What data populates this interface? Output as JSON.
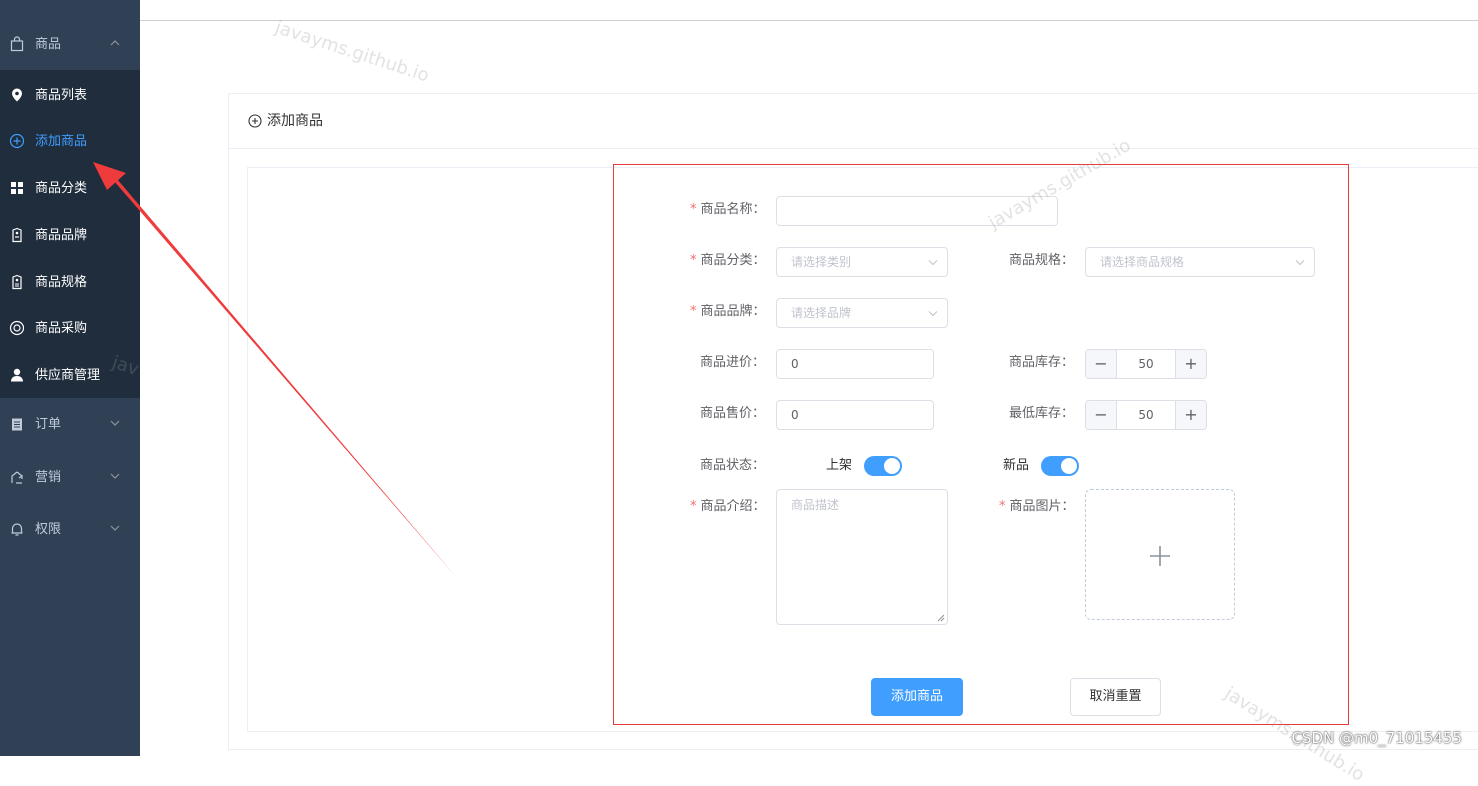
{
  "sidebar": {
    "groups": [
      {
        "label": "商品",
        "icon": "shopping-bag-icon",
        "expanded": true
      },
      {
        "label": "订单",
        "icon": "clipboard-icon",
        "expanded": false
      },
      {
        "label": "营销",
        "icon": "share-icon",
        "expanded": false
      },
      {
        "label": "权限",
        "icon": "bell-icon",
        "expanded": false
      }
    ],
    "items": [
      {
        "label": "商品列表",
        "icon": "location-pin-icon"
      },
      {
        "label": "添加商品",
        "icon": "circle-plus-icon",
        "active": true
      },
      {
        "label": "商品分类",
        "icon": "grid-icon"
      },
      {
        "label": "商品品牌",
        "icon": "tag-icon"
      },
      {
        "label": "商品规格",
        "icon": "spec-tag-icon"
      },
      {
        "label": "商品采购",
        "icon": "lifebuoy-icon"
      },
      {
        "label": "供应商管理",
        "icon": "user-icon"
      }
    ]
  },
  "card": {
    "title": "添加商品"
  },
  "form": {
    "name": {
      "label": "商品名称：",
      "value": "",
      "required": true
    },
    "category": {
      "label": "商品分类：",
      "placeholder": "请选择类别",
      "required": true
    },
    "spec": {
      "label": "商品规格：",
      "placeholder": "请选择商品规格"
    },
    "brand": {
      "label": "商品品牌：",
      "placeholder": "请选择品牌",
      "required": true
    },
    "purchase_price": {
      "label": "商品进价：",
      "value": "0"
    },
    "stock": {
      "label": "商品库存：",
      "value": "50"
    },
    "sale_price": {
      "label": "商品售价：",
      "value": "0"
    },
    "min_stock": {
      "label": "最低库存：",
      "value": "50"
    },
    "status": {
      "label": "商品状态：",
      "on_shelf_label": "上架",
      "on_shelf": true,
      "new_label": "新品",
      "is_new": true
    },
    "intro": {
      "label": "商品介绍：",
      "placeholder": "商品描述",
      "required": true
    },
    "image": {
      "label": "商品图片：",
      "required": true
    },
    "stepper_minus": "−",
    "stepper_plus": "+",
    "submit_label": "添加商品",
    "reset_label": "取消重置"
  },
  "watermarks": [
    "javayms.github.io",
    "javayms.github.io",
    "jav",
    "javayms.github.io"
  ],
  "credit": "CSDN @m0_71015455",
  "colors": {
    "sidebar": "#304156",
    "submenu": "#1f2d3d",
    "accent": "#409eff",
    "required": "#f56c6c",
    "annotation": "#e23c3c"
  }
}
